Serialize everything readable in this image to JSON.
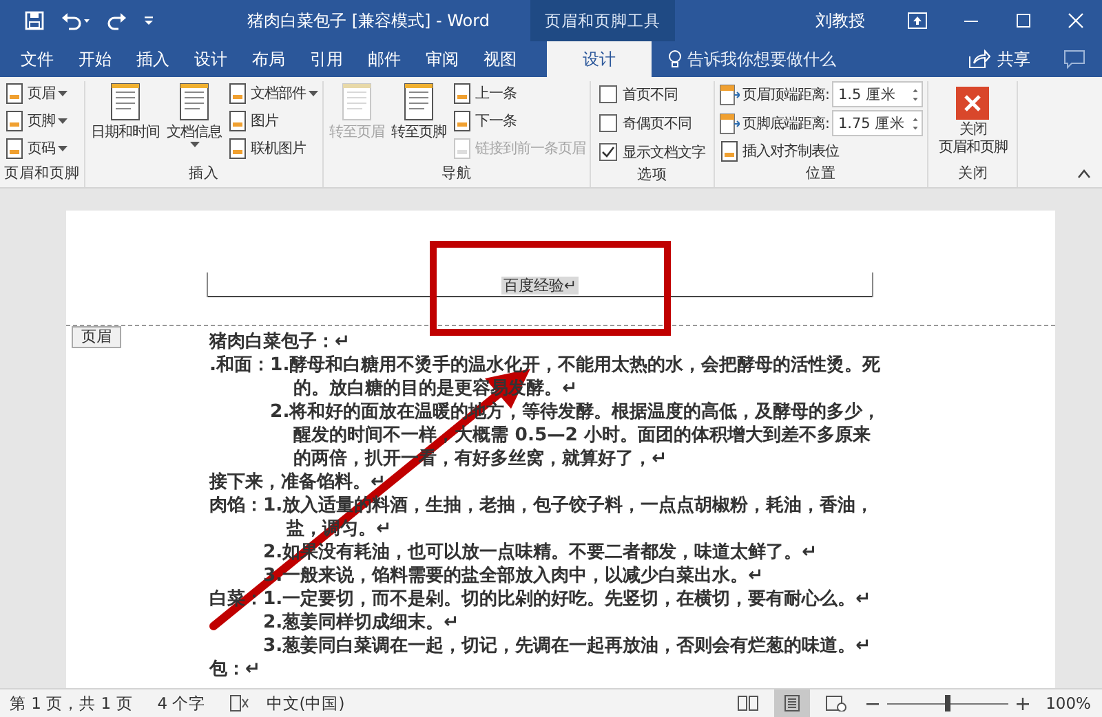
{
  "window": {
    "title": "猪肉白菜包子 [兼容模式] - Word",
    "context_tab": "页眉和页脚工具",
    "user": "刘教授"
  },
  "tabs": [
    {
      "label": "文件",
      "selected": false
    },
    {
      "label": "开始",
      "selected": false
    },
    {
      "label": "插入",
      "selected": false
    },
    {
      "label": "设计",
      "selected": false
    },
    {
      "label": "布局",
      "selected": false
    },
    {
      "label": "引用",
      "selected": false
    },
    {
      "label": "邮件",
      "selected": false
    },
    {
      "label": "审阅",
      "selected": false
    },
    {
      "label": "视图",
      "selected": false
    },
    {
      "label": "设计",
      "selected": true
    }
  ],
  "tell_me": {
    "placeholder": "告诉我你想要做什么"
  },
  "share": {
    "label": "共享"
  },
  "ribbon_groups": [
    {
      "label": "页眉和页脚",
      "columns": [
        [
          {
            "kind": "small",
            "label": "页眉",
            "dropdown": true,
            "disabled": false
          },
          {
            "kind": "small",
            "label": "页脚",
            "dropdown": true,
            "disabled": false
          },
          {
            "kind": "small",
            "label": "页码",
            "dropdown": true,
            "disabled": false
          }
        ]
      ]
    },
    {
      "label": "插入",
      "columns": [
        [
          {
            "kind": "large",
            "label": "日期和时间",
            "dropdown": false,
            "disabled": false
          }
        ],
        [
          {
            "kind": "large",
            "label": "文档信息",
            "dropdown": true,
            "disabled": false
          }
        ],
        [
          {
            "kind": "small",
            "label": "文档部件",
            "dropdown": true,
            "disabled": false
          },
          {
            "kind": "small",
            "label": "图片",
            "dropdown": false,
            "disabled": false
          },
          {
            "kind": "small",
            "label": "联机图片",
            "dropdown": false,
            "disabled": false
          }
        ]
      ]
    },
    {
      "label": "导航",
      "columns": [
        [
          {
            "kind": "large",
            "label": "转至页眉",
            "dropdown": false,
            "disabled": true
          }
        ],
        [
          {
            "kind": "large",
            "label": "转至页脚",
            "dropdown": false,
            "disabled": false
          }
        ],
        [
          {
            "kind": "small",
            "label": "上一条",
            "dropdown": false,
            "disabled": false
          },
          {
            "kind": "small",
            "label": "下一条",
            "dropdown": false,
            "disabled": false
          },
          {
            "kind": "small",
            "label": "链接到前一条页眉",
            "dropdown": false,
            "disabled": true
          }
        ]
      ]
    },
    {
      "label": "选项",
      "columns": [
        [
          {
            "kind": "checkbox",
            "label": "首页不同",
            "checked": false
          },
          {
            "kind": "checkbox",
            "label": "奇偶页不同",
            "checked": false
          },
          {
            "kind": "checkbox",
            "label": "显示文档文字",
            "checked": true
          }
        ]
      ]
    },
    {
      "label": "位置",
      "columns": [
        [
          {
            "kind": "spinner",
            "label": "页眉顶端距离:",
            "value": "1.5 厘米"
          },
          {
            "kind": "spinner",
            "label": "页脚底端距离:",
            "value": "1.75 厘米"
          },
          {
            "kind": "small",
            "label": "插入对齐制表位",
            "dropdown": false,
            "disabled": false
          }
        ]
      ]
    },
    {
      "label": "关闭",
      "columns": [
        [
          {
            "kind": "close",
            "label_lines": [
              "关闭",
              "页眉和页脚"
            ],
            "dropdown": false,
            "disabled": false
          }
        ]
      ]
    }
  ],
  "document": {
    "header_text": "百度经验↵",
    "header_tag": "页眉",
    "body": [
      {
        "kind": "line",
        "text": "猪肉白菜包子：↵"
      },
      {
        "kind": "section",
        "label": ".和面：",
        "items": [
          "1.酵母和白糖用不烫手的温水化开，不能用太热的水，会把酵母的活性烫。死的。放白糖的目的是更容易发酵。↵",
          "2.将和好的面放在温暖的地方，等待发酵。根据温度的高低，及酵母的多少，醒发的时间不一样，大概需 0.5—2 小时。面团的体积增大到差不多原来的两倍，扒开一看，有好多丝窝，就算好了，↵"
        ]
      },
      {
        "kind": "line",
        "text": "接下来，准备馅料。↵"
      },
      {
        "kind": "section",
        "label": "肉馅：",
        "items": [
          "1.放入适量的料酒，生抽，老抽，包子饺子料，一点点胡椒粉，耗油，香油，盐，调匀。↵",
          "2.如果没有耗油，也可以放一点味精。不要二者都发，味道太鲜了。↵",
          "3.一般来说，馅料需要的盐全部放入肉中，以减少白菜出水。↵"
        ]
      },
      {
        "kind": "section",
        "label": "白菜：",
        "items": [
          "1.一定要切，而不是剁。切的比剁的好吃。先竖切，在横切，要有耐心么。↵",
          "2.葱姜同样切成细末。↵",
          "3.葱姜同白菜调在一起，切记，先调在一起再放油，否则会有烂葱的味道。↵"
        ]
      },
      {
        "kind": "line",
        "text": "包：↵"
      }
    ]
  },
  "status_bar": {
    "page_info": "第 1 页，共 1 页",
    "word_count": "4 个字",
    "language": "中文(中国)",
    "views": [
      {
        "selected": false
      },
      {
        "selected": true
      },
      {
        "selected": false
      }
    ],
    "zoom": {
      "level": 0.5,
      "reading": "100%"
    }
  }
}
